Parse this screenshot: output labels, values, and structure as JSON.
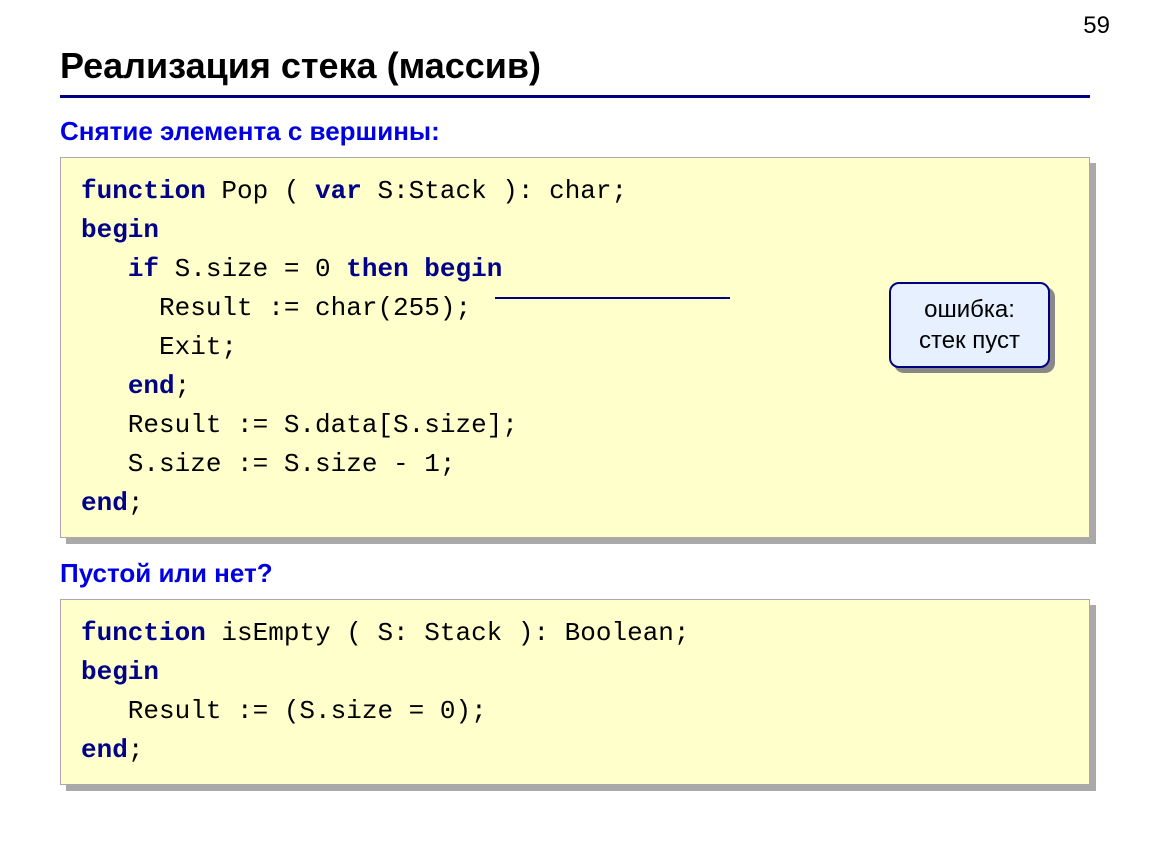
{
  "page_number": "59",
  "title": "Реализация стека (массив)",
  "section1_label": "Снятие элемента с вершины:",
  "section2_label": "Пустой или нет?",
  "callout": {
    "line1": "ошибка:",
    "line2": "стек пуст"
  },
  "code1": {
    "l1a": "function",
    "l1b": " Pop ( ",
    "l1c": "var",
    "l1d": " S:Stack ): char;",
    "l2": "begin",
    "l3a": "   ",
    "l3b": "if",
    "l3c": " S.size = 0 ",
    "l3d": "then begin",
    "l4": "     Result := char(255);",
    "l5": "     Exit;",
    "l6a": "   ",
    "l6b": "end",
    "l6c": ";",
    "l7": "   Result := S.data[S.size];",
    "l8": "   S.size := S.size - 1;",
    "l9a": "end",
    "l9b": ";"
  },
  "code2": {
    "l1a": "function",
    "l1b": " isEmpty ( S: Stack ): Boolean;",
    "l2": "begin",
    "l3": "   Result := (S.size = 0);",
    "l4a": "end",
    "l4b": ";"
  }
}
